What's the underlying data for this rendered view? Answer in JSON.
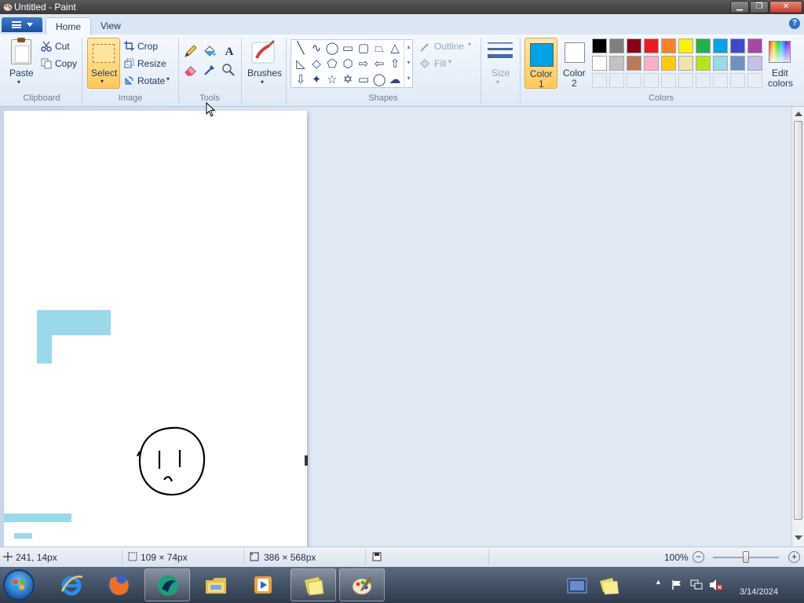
{
  "window": {
    "title": "Untitled - Paint",
    "controls": {
      "minimize": "▁",
      "maximize": "❐",
      "close": "✕"
    }
  },
  "ribbon": {
    "tabs": [
      {
        "label": "Home",
        "active": true
      },
      {
        "label": "View",
        "active": false
      }
    ],
    "help_icon": "?",
    "groups": {
      "clipboard": {
        "label": "Clipboard",
        "paste": "Paste",
        "cut": "Cut",
        "copy": "Copy"
      },
      "image": {
        "label": "Image",
        "select": "Select",
        "crop": "Crop",
        "resize": "Resize",
        "rotate": "Rotate"
      },
      "tools": {
        "label": "Tools",
        "items": [
          "pencil-icon",
          "fill-bucket-icon",
          "text-icon",
          "eraser-icon",
          "color-picker-icon",
          "magnifier-icon"
        ],
        "text_glyph": "A"
      },
      "brushes": {
        "label": "Brushes"
      },
      "shapes": {
        "label": "Shapes",
        "outline": "Outline",
        "fill": "Fill",
        "glyphs": [
          "╲",
          "∿",
          "◯",
          "▭",
          "▢",
          "⏢",
          "△",
          "◺",
          "◇",
          "⬠",
          "⬡",
          "⇨",
          "⇦",
          "⇧",
          "⇩",
          "✦",
          "☆",
          "✡",
          "▭",
          "◯",
          "☁"
        ]
      },
      "size": {
        "label": "Size"
      },
      "colors": {
        "label": "Colors",
        "color1_label_line1": "Color",
        "color1_label_line2": "1",
        "color2_label_line1": "Color",
        "color2_label_line2": "2",
        "color1": "#00a2e8",
        "color2": "#ffffff",
        "edit_line1": "Edit",
        "edit_line2": "colors",
        "palette_row1": [
          "#000000",
          "#7f7f7f",
          "#880015",
          "#ed1c24",
          "#ff7f27",
          "#fff200",
          "#22b14c",
          "#00a2e8",
          "#3f48cc",
          "#a349a4"
        ],
        "palette_row2": [
          "#ffffff",
          "#c3c3c3",
          "#b97a57",
          "#ffaec9",
          "#ffc90e",
          "#efe4b0",
          "#b5e61d",
          "#99d9ea",
          "#7092be",
          "#c8bfe7"
        ]
      }
    }
  },
  "status": {
    "cursor_pos": "241, 14px",
    "selection_size": "109 × 74px",
    "image_size": "386 × 568px",
    "zoom": "100%",
    "zoom_level": 1.0
  },
  "canvas_fill_color": "#99d9ea",
  "taskbar": {
    "apps": [
      "internet-explorer-icon",
      "firefox-icon",
      "app-icon",
      "windows-explorer-icon",
      "media-player-icon",
      "sticky-notes-icon",
      "paint-icon"
    ],
    "tray_date": "3/14/2024"
  }
}
